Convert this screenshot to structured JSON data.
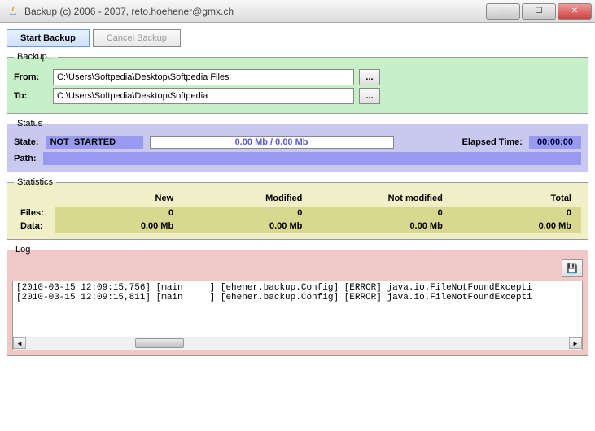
{
  "window": {
    "title": "Backup (c) 2006 - 2007, reto.hoehener@gmx.ch"
  },
  "buttons": {
    "start": "Start Backup",
    "cancel": "Cancel Backup"
  },
  "backup": {
    "legend": "Backup...",
    "from_label": "From:",
    "to_label": "To:",
    "from_value": "C:\\Users\\Softpedia\\Desktop\\Softpedia Files",
    "to_value": "C:\\Users\\Softpedia\\Desktop\\Softpedia",
    "browse": "..."
  },
  "status": {
    "legend": "Status",
    "state_label": "State:",
    "state_value": "NOT_STARTED",
    "progress_text": "0.00 Mb / 0.00 Mb",
    "elapsed_label": "Elapsed Time:",
    "elapsed_value": "00:00:00",
    "path_label": "Path:",
    "path_value": ""
  },
  "stats": {
    "legend": "Statistics",
    "headers": {
      "new": "New",
      "modified": "Modified",
      "not_modified": "Not modified",
      "total": "Total"
    },
    "files_label": "Files:",
    "data_label": "Data:",
    "files": {
      "new": "0",
      "modified": "0",
      "not_modified": "0",
      "total": "0"
    },
    "data": {
      "new": "0.00 Mb",
      "modified": "0.00 Mb",
      "not_modified": "0.00 Mb",
      "total": "0.00 Mb"
    }
  },
  "log": {
    "legend": "Log",
    "line1": "[2010-03-15 12:09:15,756] [main     ] [ehener.backup.Config] [ERROR] java.io.FileNotFoundExcepti",
    "line2": "[2010-03-15 12:09:15,811] [main     ] [ehener.backup.Config] [ERROR] java.io.FileNotFoundExcepti"
  }
}
